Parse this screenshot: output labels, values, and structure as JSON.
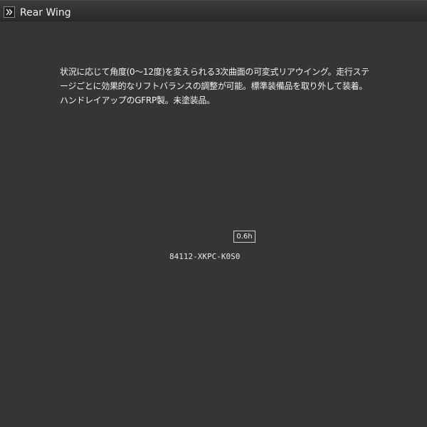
{
  "header": {
    "title": "Rear Wing",
    "expand_icon": "double-chevron-right-icon"
  },
  "item": {
    "description": "状況に応じて角度(0〜12度)を変えられる3次曲面の可変式リアウイング。走行ステージごとに効果的なリフトバランスの調整が可能。標準装備品を取り外して装着。ハンドレイアップのGFRP製。未塗装品。",
    "duration": "0.6h",
    "part_number": "84112-XKPC-K0S0"
  },
  "colors": {
    "background": "#353535",
    "titlebar": "#2f2f2f",
    "text": "#ffffff"
  }
}
